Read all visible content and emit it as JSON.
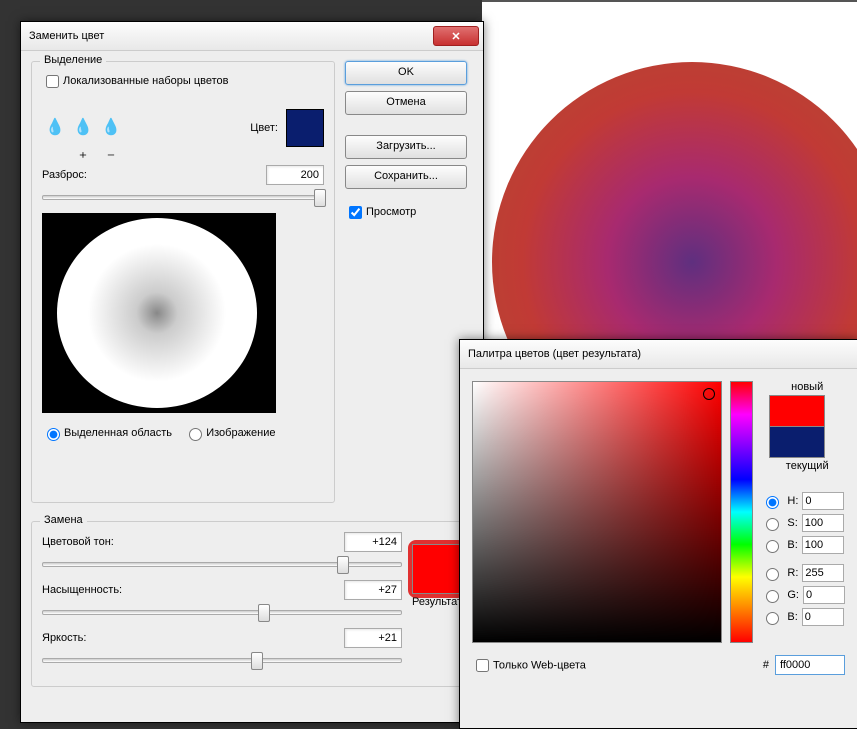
{
  "replace_dialog": {
    "title": "Заменить цвет",
    "selection": {
      "legend": "Выделение",
      "localized_sets": "Локализованные наборы цветов",
      "color_label": "Цвет:",
      "color_hex": "#0a1e6e",
      "fuzziness_label": "Разброс:",
      "fuzziness_value": "200",
      "radio_selection": "Выделенная область",
      "radio_image": "Изображение"
    },
    "replace": {
      "legend": "Замена",
      "hue_label": "Цветовой тон:",
      "hue_value": "+124",
      "sat_label": "Насыщенность:",
      "sat_value": "+27",
      "light_label": "Яркость:",
      "light_value": "+21",
      "result_label": "Результат",
      "result_hex": "#ff0000"
    },
    "buttons": {
      "ok": "OK",
      "cancel": "Отмена",
      "load": "Загрузить...",
      "save": "Сохранить...",
      "preview": "Просмотр"
    }
  },
  "color_picker": {
    "title": "Палитра цветов (цвет результата)",
    "new_label": "новый",
    "current_label": "текущий",
    "new_hex": "#ff0000",
    "current_hex": "#0a1e6e",
    "h": {
      "label": "H:",
      "value": "0"
    },
    "s": {
      "label": "S:",
      "value": "100"
    },
    "b": {
      "label": "B:",
      "value": "100"
    },
    "r": {
      "label": "R:",
      "value": "255"
    },
    "g": {
      "label": "G:",
      "value": "0"
    },
    "bb": {
      "label": "B:",
      "value": "0"
    },
    "web_only": "Только Web-цвета",
    "hex_label": "#",
    "hex_value": "ff0000"
  }
}
